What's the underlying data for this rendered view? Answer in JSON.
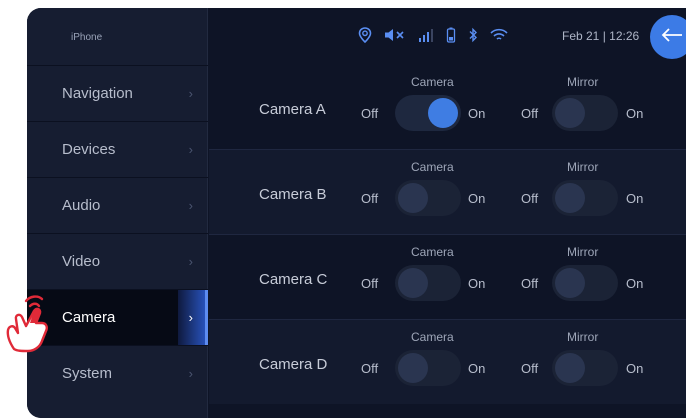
{
  "device": {
    "label": "iPhone"
  },
  "sidebar": {
    "items": [
      {
        "label": "Navigation",
        "active": false
      },
      {
        "label": "Devices",
        "active": false
      },
      {
        "label": "Audio",
        "active": false
      },
      {
        "label": "Video",
        "active": false
      },
      {
        "label": "Camera",
        "active": true
      },
      {
        "label": "System",
        "active": false
      }
    ]
  },
  "status": {
    "datetime": "Feb 21 | 12:26",
    "icons": [
      "location-icon",
      "mute-icon",
      "signal-icon",
      "battery-icon",
      "bluetooth-icon",
      "wifi-icon"
    ]
  },
  "cameras": {
    "column_labels": {
      "camera": "Camera",
      "mirror": "Mirror"
    },
    "off_label": "Off",
    "on_label": "On",
    "rows": [
      {
        "name": "Camera A",
        "camera_on": true,
        "mirror_on": false
      },
      {
        "name": "Camera B",
        "camera_on": false,
        "mirror_on": false
      },
      {
        "name": "Camera C",
        "camera_on": false,
        "mirror_on": false
      },
      {
        "name": "Camera D",
        "camera_on": false,
        "mirror_on": false
      }
    ]
  },
  "colors": {
    "accent": "#3c7be6",
    "background": "#0e1426",
    "sidebar": "#161d31",
    "hand": "#e02a38"
  }
}
